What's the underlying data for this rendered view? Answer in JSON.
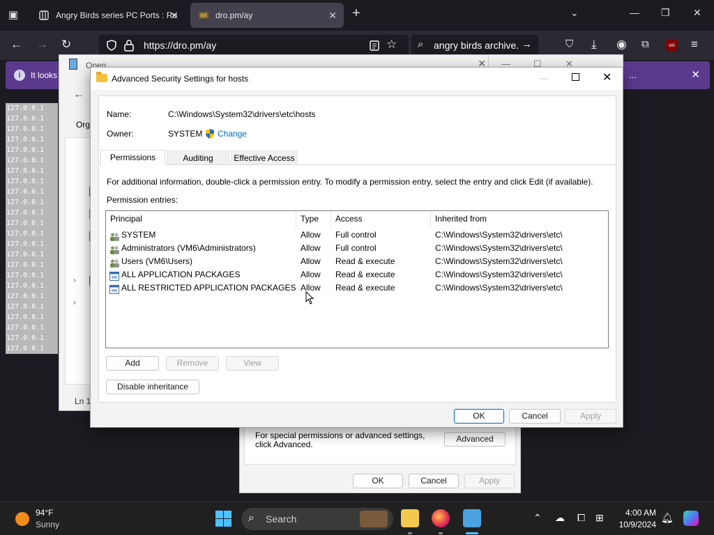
{
  "browser": {
    "tabs": [
      {
        "title": "Angry Birds series PC Ports : Ro",
        "active": false
      },
      {
        "title": "dro.pm/ay",
        "active": true
      }
    ],
    "url": "https://dro.pm/ay",
    "search_text": "angry birds archive.",
    "infobar_text": "It looks",
    "infobar_more": "..."
  },
  "hosts_lines": [
    "127.0.0.1",
    "127.0.0.1",
    "127.0.0.1",
    "127.0.0.1",
    "127.0.0.1",
    "127.0.0.1",
    "127.0.0.1",
    "127.0.0.1",
    "127.0.0.1",
    "127.0.0.1",
    "127.0.0.1",
    "127.0.0.1",
    "127.0.0.1",
    "127.0.0.1",
    "127.0.0.1",
    "127.0.0.1",
    "127.0.0.1",
    "127.0.0.1",
    "127.0.0.1",
    "127.0.0.1",
    "127.0.0.1",
    "127.0.0.1",
    "127.0.0.1",
    "127.0.0.1"
  ],
  "open_dialog": {
    "title": "Open",
    "org_label": "Org",
    "ln_label": "Ln 1,"
  },
  "properties_dialog": {
    "special_text": "For special permissions or advanced settings, click Advanced.",
    "advanced_label": "Advanced",
    "ok_label": "OK",
    "cancel_label": "Cancel",
    "apply_label": "Apply"
  },
  "advanced_security": {
    "title": "Advanced Security Settings for hosts",
    "name_label": "Name:",
    "name_value": "C:\\Windows\\System32\\drivers\\etc\\hosts",
    "owner_label": "Owner:",
    "owner_value": "SYSTEM",
    "change_label": "Change",
    "tabs": [
      "Permissions",
      "Auditing",
      "Effective Access"
    ],
    "info_text": "For additional information, double-click a permission entry. To modify a permission entry, select the entry and click Edit (if available).",
    "entries_label": "Permission entries:",
    "columns": [
      "Principal",
      "Type",
      "Access",
      "Inherited from"
    ],
    "entries": [
      {
        "principal": "SYSTEM",
        "type": "Allow",
        "access": "Full control",
        "inherited": "C:\\Windows\\System32\\drivers\\etc\\",
        "icon": "user-group-icon"
      },
      {
        "principal": "Administrators (VM6\\Administrators)",
        "type": "Allow",
        "access": "Full control",
        "inherited": "C:\\Windows\\System32\\drivers\\etc\\",
        "icon": "user-group-icon"
      },
      {
        "principal": "Users (VM6\\Users)",
        "type": "Allow",
        "access": "Read & execute",
        "inherited": "C:\\Windows\\System32\\drivers\\etc\\",
        "icon": "user-group-icon"
      },
      {
        "principal": "ALL APPLICATION PACKAGES",
        "type": "Allow",
        "access": "Read & execute",
        "inherited": "C:\\Windows\\System32\\drivers\\etc\\",
        "icon": "app-package-icon"
      },
      {
        "principal": "ALL RESTRICTED APPLICATION PACKAGES",
        "type": "Allow",
        "access": "Read & execute",
        "inherited": "C:\\Windows\\System32\\drivers\\etc\\",
        "icon": "app-package-icon"
      }
    ],
    "add_label": "Add",
    "remove_label": "Remove",
    "view_label": "View",
    "disable_inheritance_label": "Disable inheritance",
    "ok_label": "OK",
    "cancel_label": "Cancel",
    "apply_label": "Apply"
  },
  "taskbar": {
    "temperature": "94°F",
    "condition": "Sunny",
    "search_placeholder": "Search",
    "time": "4:00 AM",
    "date": "10/9/2024"
  },
  "colors": {
    "accent": "#0067c0",
    "infobar": "#5b3a8e",
    "taskbar": "#202020"
  }
}
